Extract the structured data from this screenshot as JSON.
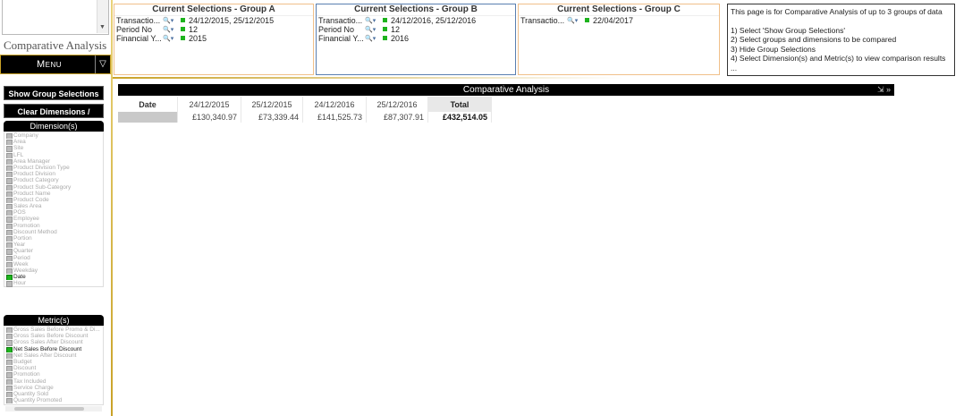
{
  "app": {
    "title": "Comparative Analysis",
    "menu_label": "Menu"
  },
  "buttons": {
    "show_group_selections": "Show Group Selections",
    "clear_dimensions_metrics": "Clear Dimensions / Metrics"
  },
  "dimensions": {
    "title": "Dimension(s)",
    "items": [
      "Company",
      "Area",
      "Site",
      "LFL",
      "Area Manager",
      "Product Division Type",
      "Product Division",
      "Product Category",
      "Product Sub-Category",
      "Product Name",
      "Product Code",
      "Sales Area",
      "POS",
      "Employee",
      "Promotion",
      "Discount Method",
      "Portion",
      "Year",
      "Quarter",
      "Period",
      "Week",
      "Weekday",
      "Date",
      "Hour"
    ],
    "selected": "Date"
  },
  "metrics": {
    "title": "Metric(s)",
    "items": [
      "Gross Sales Before Promo & Di...",
      "Gross Sales Before Discount",
      "Gross Sales After Discount",
      "Net Sales Before Discount",
      "Net Sales After Discount",
      "Budget",
      "Discount",
      "Promotion",
      "Tax Included",
      "Service Charge",
      "Quantity Sold",
      "Quantity Promoted"
    ],
    "selected": "Net Sales Before Discount"
  },
  "groups": [
    {
      "title": "Current Selections - Group A",
      "rows": [
        {
          "field": "Transactio...",
          "value": "24/12/2015, 25/12/2015"
        },
        {
          "field": "Period No",
          "value": "12"
        },
        {
          "field": "Financial Y...",
          "value": "2015"
        }
      ]
    },
    {
      "title": "Current Selections - Group B",
      "rows": [
        {
          "field": "Transactio...",
          "value": "24/12/2016, 25/12/2016"
        },
        {
          "field": "Period No",
          "value": "12"
        },
        {
          "field": "Financial Y...",
          "value": "2016"
        }
      ]
    },
    {
      "title": "Current Selections - Group C",
      "rows": [
        {
          "field": "Transactio...",
          "value": "22/04/2017"
        }
      ]
    }
  ],
  "info": {
    "lines": [
      "This page is for Comparative Analysis of up to 3 groups of data",
      "",
      "1) Select 'Show Group Selections'",
      "2) Select groups and dimensions to be compared",
      "3) Hide Group Selections",
      "4) Select Dimension(s) and Metric(s) to view comparison results",
      "..."
    ]
  },
  "pivot": {
    "title": "Comparative Analysis",
    "tools": "⇲ »",
    "row_header": "Date",
    "columns": [
      "24/12/2015",
      "25/12/2015",
      "24/12/2016",
      "25/12/2016",
      "Total"
    ],
    "values": [
      "£130,340.97",
      "£73,339.44",
      "£141,525.73",
      "£87,307.91",
      "£432,514.05"
    ]
  }
}
